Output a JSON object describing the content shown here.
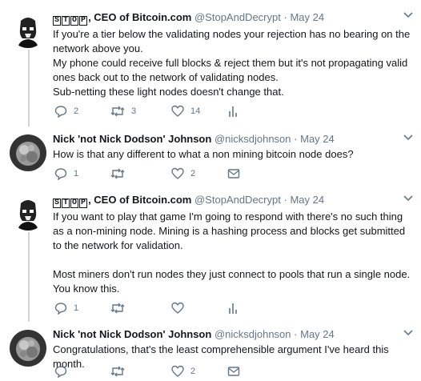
{
  "tweets": [
    {
      "badge": [
        "S",
        "T",
        "O",
        "P"
      ],
      "name": "CEO of Bitcoin.com",
      "handle": "@StopAndDecrypt",
      "date": "May 24",
      "lines": [
        "If you're a tier below the validating nodes your rejection has no bearing on the network above you.",
        "My phone could receive full blocks & reject them but it's not propagating valid ones back out to the network of validating nodes.",
        "Sub-netting these light nodes doesn't change that."
      ],
      "actions": {
        "reply": "2",
        "retweet": "3",
        "like": "14",
        "fourth_icon": "analytics-icon"
      }
    },
    {
      "name": "Nick 'not Nick Dodson' Johnson",
      "handle": "@nicksdjohnson",
      "date": "May 24",
      "lines": [
        "How is that any different to what a non mining bitcoin node does?"
      ],
      "actions": {
        "reply": "1",
        "retweet": "",
        "like": "2",
        "fourth_icon": "mail-icon"
      }
    },
    {
      "badge": [
        "S",
        "T",
        "O",
        "P"
      ],
      "name": "CEO of Bitcoin.com",
      "handle": "@StopAndDecrypt",
      "date": "May 24",
      "lines": [
        "If you want to play that game I'm going to respond with there's no such thing as a non-mining node. Mining is a hashing process and blocks get submitted to the network for validation.",
        "",
        "Most miners don't run nodes they just connect to pools that run a single node. You know this."
      ],
      "actions": {
        "reply": "1",
        "retweet": "",
        "like": "",
        "fourth_icon": "analytics-icon"
      }
    },
    {
      "name": "Nick 'not Nick Dodson' Johnson",
      "handle": "@nicksdjohnson",
      "date": "May 24",
      "lines": [
        "Congratulations, that's the least comprehensible argument I've heard this month."
      ],
      "actions": {
        "reply": "",
        "retweet": "",
        "like": "2",
        "fourth_icon": "mail-icon"
      }
    }
  ],
  "separator": "·",
  "colors": {
    "text": "#14171a",
    "muted": "#657786",
    "thread_line": "#ccd6dd"
  }
}
